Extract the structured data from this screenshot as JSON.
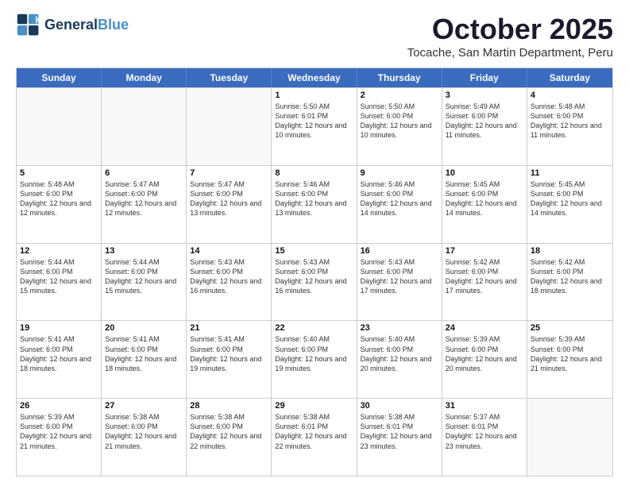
{
  "header": {
    "logo_line1": "General",
    "logo_line2": "Blue",
    "month": "October 2025",
    "location": "Tocache, San Martin Department, Peru"
  },
  "weekdays": [
    "Sunday",
    "Monday",
    "Tuesday",
    "Wednesday",
    "Thursday",
    "Friday",
    "Saturday"
  ],
  "rows": [
    [
      {
        "day": "",
        "info": ""
      },
      {
        "day": "",
        "info": ""
      },
      {
        "day": "",
        "info": ""
      },
      {
        "day": "1",
        "info": "Sunrise: 5:50 AM\nSunset: 6:01 PM\nDaylight: 12 hours\nand 10 minutes."
      },
      {
        "day": "2",
        "info": "Sunrise: 5:50 AM\nSunset: 6:00 PM\nDaylight: 12 hours\nand 10 minutes."
      },
      {
        "day": "3",
        "info": "Sunrise: 5:49 AM\nSunset: 6:00 PM\nDaylight: 12 hours\nand 11 minutes."
      },
      {
        "day": "4",
        "info": "Sunrise: 5:48 AM\nSunset: 6:00 PM\nDaylight: 12 hours\nand 11 minutes."
      }
    ],
    [
      {
        "day": "5",
        "info": "Sunrise: 5:48 AM\nSunset: 6:00 PM\nDaylight: 12 hours\nand 12 minutes."
      },
      {
        "day": "6",
        "info": "Sunrise: 5:47 AM\nSunset: 6:00 PM\nDaylight: 12 hours\nand 12 minutes."
      },
      {
        "day": "7",
        "info": "Sunrise: 5:47 AM\nSunset: 6:00 PM\nDaylight: 12 hours\nand 13 minutes."
      },
      {
        "day": "8",
        "info": "Sunrise: 5:46 AM\nSunset: 6:00 PM\nDaylight: 12 hours\nand 13 minutes."
      },
      {
        "day": "9",
        "info": "Sunrise: 5:46 AM\nSunset: 6:00 PM\nDaylight: 12 hours\nand 14 minutes."
      },
      {
        "day": "10",
        "info": "Sunrise: 5:45 AM\nSunset: 6:00 PM\nDaylight: 12 hours\nand 14 minutes."
      },
      {
        "day": "11",
        "info": "Sunrise: 5:45 AM\nSunset: 6:00 PM\nDaylight: 12 hours\nand 14 minutes."
      }
    ],
    [
      {
        "day": "12",
        "info": "Sunrise: 5:44 AM\nSunset: 6:00 PM\nDaylight: 12 hours\nand 15 minutes."
      },
      {
        "day": "13",
        "info": "Sunrise: 5:44 AM\nSunset: 6:00 PM\nDaylight: 12 hours\nand 15 minutes."
      },
      {
        "day": "14",
        "info": "Sunrise: 5:43 AM\nSunset: 6:00 PM\nDaylight: 12 hours\nand 16 minutes."
      },
      {
        "day": "15",
        "info": "Sunrise: 5:43 AM\nSunset: 6:00 PM\nDaylight: 12 hours\nand 16 minutes."
      },
      {
        "day": "16",
        "info": "Sunrise: 5:43 AM\nSunset: 6:00 PM\nDaylight: 12 hours\nand 17 minutes."
      },
      {
        "day": "17",
        "info": "Sunrise: 5:42 AM\nSunset: 6:00 PM\nDaylight: 12 hours\nand 17 minutes."
      },
      {
        "day": "18",
        "info": "Sunrise: 5:42 AM\nSunset: 6:00 PM\nDaylight: 12 hours\nand 18 minutes."
      }
    ],
    [
      {
        "day": "19",
        "info": "Sunrise: 5:41 AM\nSunset: 6:00 PM\nDaylight: 12 hours\nand 18 minutes."
      },
      {
        "day": "20",
        "info": "Sunrise: 5:41 AM\nSunset: 6:00 PM\nDaylight: 12 hours\nand 18 minutes."
      },
      {
        "day": "21",
        "info": "Sunrise: 5:41 AM\nSunset: 6:00 PM\nDaylight: 12 hours\nand 19 minutes."
      },
      {
        "day": "22",
        "info": "Sunrise: 5:40 AM\nSunset: 6:00 PM\nDaylight: 12 hours\nand 19 minutes."
      },
      {
        "day": "23",
        "info": "Sunrise: 5:40 AM\nSunset: 6:00 PM\nDaylight: 12 hours\nand 20 minutes."
      },
      {
        "day": "24",
        "info": "Sunrise: 5:39 AM\nSunset: 6:00 PM\nDaylight: 12 hours\nand 20 minutes."
      },
      {
        "day": "25",
        "info": "Sunrise: 5:39 AM\nSunset: 6:00 PM\nDaylight: 12 hours\nand 21 minutes."
      }
    ],
    [
      {
        "day": "26",
        "info": "Sunrise: 5:39 AM\nSunset: 6:00 PM\nDaylight: 12 hours\nand 21 minutes."
      },
      {
        "day": "27",
        "info": "Sunrise: 5:38 AM\nSunset: 6:00 PM\nDaylight: 12 hours\nand 21 minutes."
      },
      {
        "day": "28",
        "info": "Sunrise: 5:38 AM\nSunset: 6:00 PM\nDaylight: 12 hours\nand 22 minutes."
      },
      {
        "day": "29",
        "info": "Sunrise: 5:38 AM\nSunset: 6:01 PM\nDaylight: 12 hours\nand 22 minutes."
      },
      {
        "day": "30",
        "info": "Sunrise: 5:38 AM\nSunset: 6:01 PM\nDaylight: 12 hours\nand 23 minutes."
      },
      {
        "day": "31",
        "info": "Sunrise: 5:37 AM\nSunset: 6:01 PM\nDaylight: 12 hours\nand 23 minutes."
      },
      {
        "day": "",
        "info": ""
      }
    ]
  ]
}
